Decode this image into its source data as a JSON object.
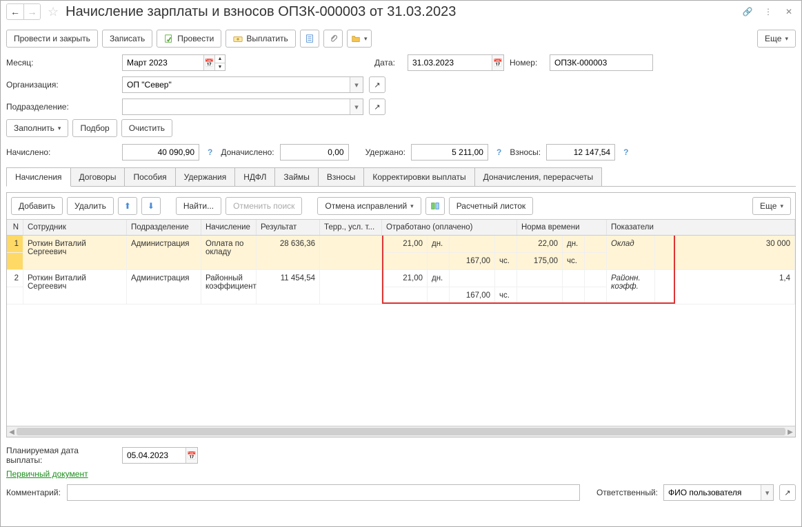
{
  "header": {
    "title": "Начисление зарплаты и взносов ОПЗК-000003 от 31.03.2023"
  },
  "toolbar": {
    "post_close": "Провести и закрыть",
    "save": "Записать",
    "post": "Провести",
    "pay": "Выплатить",
    "more": "Еще"
  },
  "form": {
    "month_label": "Месяц:",
    "month_value": "Март 2023",
    "date_label": "Дата:",
    "date_value": "31.03.2023",
    "number_label": "Номер:",
    "number_value": "ОПЗК-000003",
    "org_label": "Организация:",
    "org_value": "ОП \"Север\"",
    "dept_label": "Подразделение:",
    "dept_value": ""
  },
  "fillbar": {
    "fill": "Заполнить",
    "pick": "Подбор",
    "clear": "Очистить"
  },
  "totals": {
    "accrued_label": "Начислено:",
    "accrued": "40 090,90",
    "extra_label": "Доначислено:",
    "extra": "0,00",
    "withheld_label": "Удержано:",
    "withheld": "5 211,00",
    "contrib_label": "Взносы:",
    "contrib": "12 147,54"
  },
  "tabs": {
    "accruals": "Начисления",
    "contracts": "Договоры",
    "benefits": "Пособия",
    "deductions": "Удержания",
    "ndfl": "НДФЛ",
    "loans": "Займы",
    "contributions": "Взносы",
    "corrections": "Корректировки выплаты",
    "recalc": "Доначисления, перерасчеты"
  },
  "gridbar": {
    "add": "Добавить",
    "del": "Удалить",
    "find": "Найти...",
    "cancel_find": "Отменить поиск",
    "cancel_corr": "Отмена исправлений",
    "payslip": "Расчетный листок",
    "more": "Еще"
  },
  "gridheader": {
    "n": "N",
    "employee": "Сотрудник",
    "dept": "Подразделение",
    "accrual": "Начисление",
    "result": "Результат",
    "terr": "Терр., усл. т...",
    "worked": "Отработано (оплачено)",
    "norm": "Норма времени",
    "indicators": "Показатели"
  },
  "rows": [
    {
      "n": "1",
      "emp": "Роткин Виталий Сергеевич",
      "dept": "Администрация",
      "accr": "Оплата по окладу",
      "res": "28 636,36",
      "wd": "21,00",
      "wdu": "дн.",
      "wh": "167,00",
      "whu": "чс.",
      "nd": "22,00",
      "ndu": "дн.",
      "nh": "175,00",
      "nhu": "чс.",
      "ind": "Оклад",
      "indv": "30 000"
    },
    {
      "n": "2",
      "emp": "Роткин Виталий Сергеевич",
      "dept": "Администрация",
      "accr": "Районный коэффициент",
      "res": "11 454,54",
      "wd": "21,00",
      "wdu": "дн.",
      "wh": "167,00",
      "whu": "чс.",
      "nd": "",
      "ndu": "",
      "nh": "",
      "nhu": "",
      "ind": "Районн. коэфф.",
      "indv": "1,4"
    }
  ],
  "footer": {
    "planned_label": "Планируемая дата выплаты:",
    "planned_value": "05.04.2023",
    "primary_doc": "Первичный документ",
    "comment_label": "Комментарий:",
    "comment_value": "",
    "responsible_label": "Ответственный:",
    "responsible_value": "ФИО пользователя"
  }
}
